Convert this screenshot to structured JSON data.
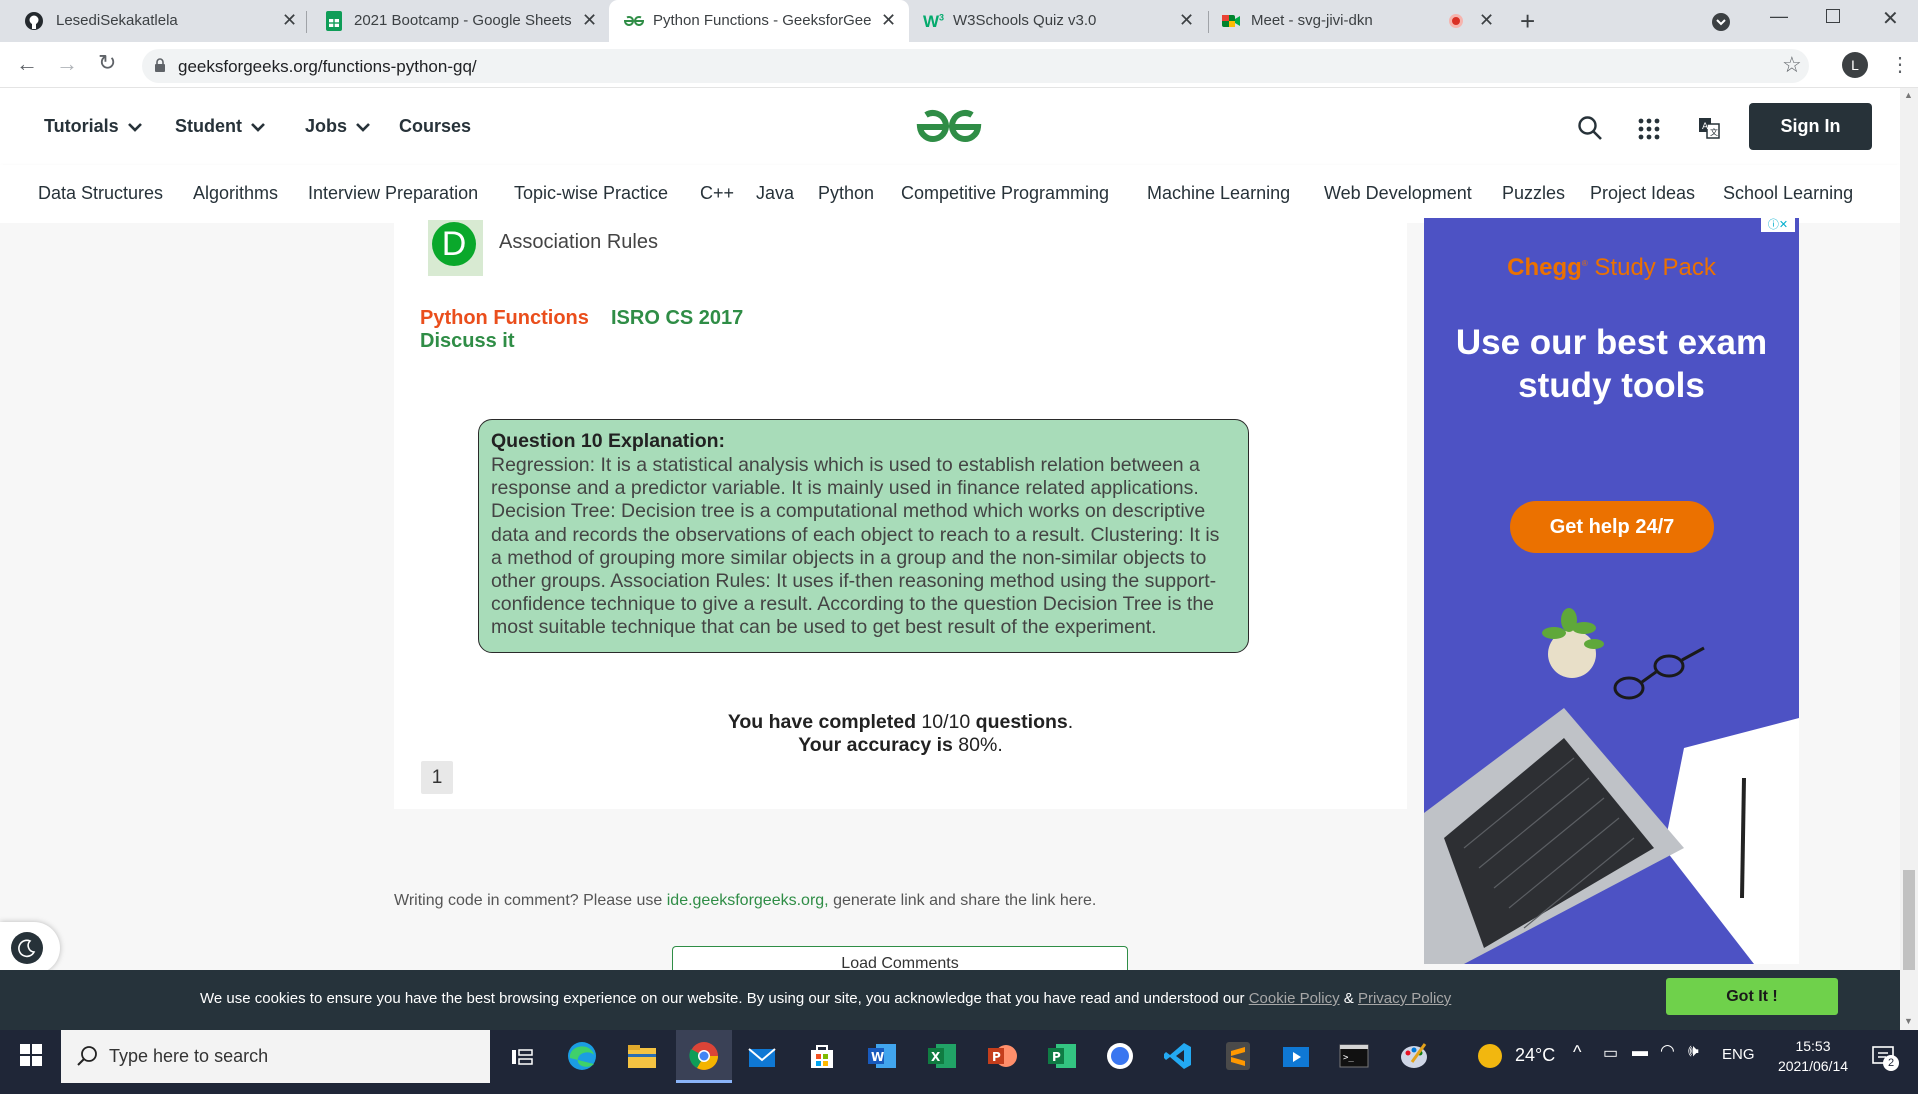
{
  "browser": {
    "tabs": [
      {
        "title": "LesediSekakatlela",
        "icon": "github-icon"
      },
      {
        "title": "2021 Bootcamp - Google Sheets",
        "icon": "google-sheets-icon"
      },
      {
        "title": "Python Functions - GeeksforGeeks",
        "icon": "gfg-icon",
        "active": true
      },
      {
        "title": "W3Schools Quiz v3.0",
        "icon": "w3schools-icon"
      },
      {
        "title": "Meet - svg-jivi-dkn",
        "icon": "google-meet-icon"
      }
    ],
    "url": "geeksforgeeks.org/functions-python-gq/",
    "profile_initial": "L"
  },
  "header": {
    "nav": [
      "Tutorials",
      "Student",
      "Jobs",
      "Courses"
    ],
    "signin_label": "Sign In",
    "subnav": [
      "Data Structures",
      "Algorithms",
      "Interview Preparation",
      "Topic-wise Practice",
      "C++",
      "Java",
      "Python",
      "Competitive Programming",
      "Machine Learning",
      "Web Development",
      "Puzzles",
      "Project Ideas",
      "School Learning"
    ]
  },
  "quiz": {
    "option_letter": "D",
    "option_text": "Association Rules",
    "tag_primary": "Python Functions",
    "tag_secondary": "ISRO CS 2017",
    "discuss_label": "Discuss it",
    "explanation_title": "Question 10 Explanation:",
    "explanation_lines": [
      "Regression: It is a statistical analysis which is used to establish relation between a",
      "response and a predictor variable. It is mainly used in finance related applications.",
      "Decision Tree: Decision tree is a computational method which works on descriptive",
      "data and records the observations of each object to reach to a result. Clustering: It is",
      "a method of grouping more similar objects in a group and the non-similar objects to",
      "other groups. Association Rules: It uses if-then reasoning method using the support-",
      "confidence technique to give a result. According to the question Decision Tree is the",
      "most suitable technique that can be used to get best result of the experiment."
    ],
    "completed_prefix": "You have completed",
    "completed_value": "10/10",
    "completed_suffix": "questions",
    "accuracy_prefix": "Your accuracy is",
    "accuracy_value": "80%",
    "page_number": "1"
  },
  "comments": {
    "note_prefix": "Writing code in comment? Please use",
    "note_link": "ide.geeksforgeeks.org,",
    "note_suffix": "generate link and share the link here.",
    "load_label": "Load Comments"
  },
  "ad": {
    "brand": "Chegg",
    "brand_suffix": "Study Pack",
    "headline_1": "Use our best exam",
    "headline_2": "study tools",
    "cta": "Get help 24/7"
  },
  "cookie": {
    "text": "We use cookies to ensure you have the best browsing experience on our website. By using our site, you acknowledge that you have read and understood our",
    "cookie_policy": "Cookie Policy",
    "amp": "&",
    "privacy_policy": "Privacy Policy",
    "button": "Got It !"
  },
  "taskbar": {
    "search_placeholder": "Type here to search",
    "weather": "24°C",
    "lang": "ENG",
    "time": "15:53",
    "date": "2021/06/14",
    "notifications": "2"
  },
  "colors": {
    "gfg_green": "#2f8d46",
    "tag_orange": "#ea4e1c",
    "dark": "#273239",
    "ad_bg": "#4d52c4",
    "cta_orange": "#eb7100"
  }
}
